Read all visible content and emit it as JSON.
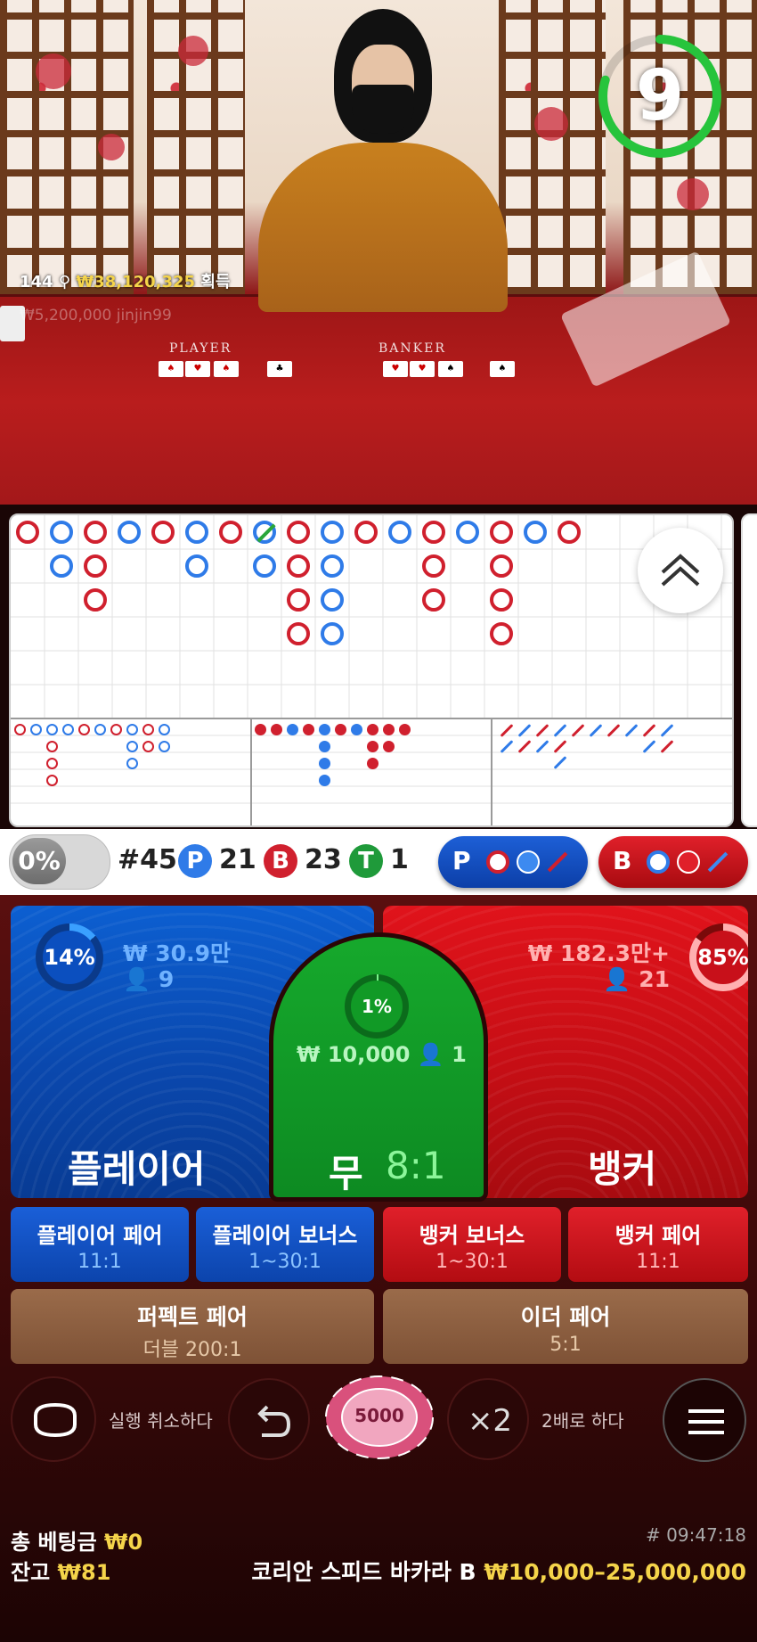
{
  "video": {
    "timer": "9",
    "winner_count": "144",
    "winner_amount": "₩38,120,325",
    "winner_suffix": "획득",
    "recent_bet": "₩5,200,000  jinjin99",
    "felt_player": "PLAYER",
    "felt_banker": "BANKER"
  },
  "stats": {
    "percent_toggle": "0%",
    "round": "#45",
    "p_badge": "P",
    "p_count": "21",
    "b_badge": "B",
    "b_count": "23",
    "t_badge": "T",
    "t_count": "1",
    "predict_player": "P",
    "predict_banker": "B"
  },
  "bets": {
    "player": {
      "name": "플레이어",
      "percent": "14%",
      "amount": "₩ 30.9만",
      "players": "9"
    },
    "tie": {
      "name": "무",
      "odds": "8:1",
      "percent": "1%",
      "amount": "₩ 10,000",
      "players": "1"
    },
    "banker": {
      "name": "뱅커",
      "percent": "85%",
      "amount": "₩ 182.3만+",
      "players": "21"
    },
    "side": [
      {
        "title": "플레이어 페어",
        "odds": "11:1"
      },
      {
        "title": "플레이어 보너스",
        "odds": "1~30:1"
      },
      {
        "title": "뱅커 보너스",
        "odds": "1~30:1"
      },
      {
        "title": "뱅커 페어",
        "odds": "11:1"
      }
    ],
    "perfect_pair": {
      "title": "퍼펙트 페어",
      "odds": "더블 200:1"
    },
    "either_pair": {
      "title": "이더 페어",
      "odds": "5:1"
    }
  },
  "controls": {
    "undo_label": "실행 취소하다",
    "chip_value": "5000",
    "double_icon": "×2",
    "double_label": "2배로 하다"
  },
  "footer": {
    "total_bet_label": "총 베팅금",
    "total_bet_value": "₩0",
    "balance_label": "잔고",
    "balance_value": "₩81",
    "time": "# 09:47:18",
    "table_name": "코리안 스피드 바카라 B",
    "table_limits": "₩10,000–25,000,000"
  },
  "colors": {
    "player": "#0c5fd1",
    "banker": "#e0131b",
    "tie": "#16a92c",
    "gold": "#f5d44a"
  }
}
